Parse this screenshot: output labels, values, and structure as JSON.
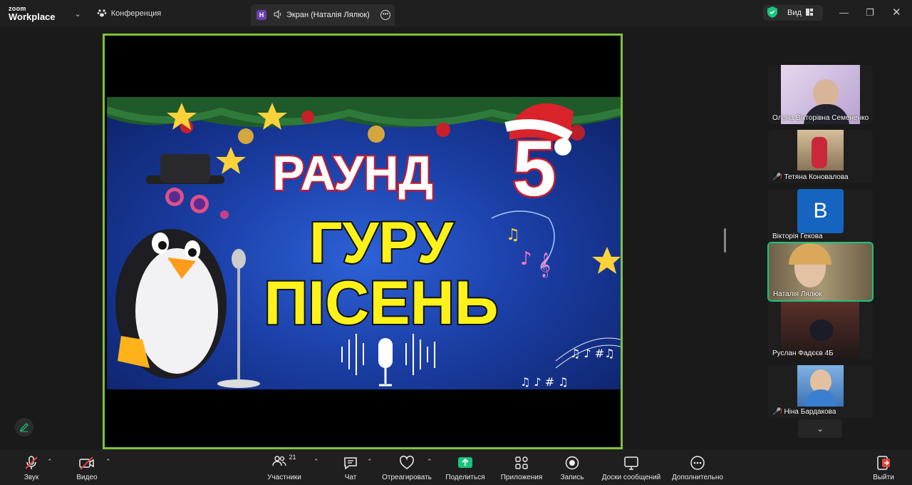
{
  "app": {
    "logo_line1": "zoom",
    "logo_line2": "Workplace"
  },
  "tabs": {
    "conference": "Конференция",
    "screen_badge": "Н",
    "screen": "Экран (Наталія Лялюк)"
  },
  "view": {
    "label": "Вид"
  },
  "slide": {
    "line1": "РАУНД",
    "round_number": "5",
    "line2": "ГУРУ",
    "line3": "ПІСЕНЬ"
  },
  "participants": [
    {
      "name": "Олена Вікторівна Семененко",
      "muted": false,
      "type": "video",
      "bg": "#c9b6d8"
    },
    {
      "name": "Тетяна Коновалова",
      "muted": true,
      "type": "video",
      "bg": "#b8a080"
    },
    {
      "name": "Вікторія Гекова",
      "muted": false,
      "type": "avatar",
      "initial": "В",
      "bg": "#1565c0"
    },
    {
      "name": "Наталія Лялюк",
      "muted": false,
      "type": "video",
      "active": true,
      "bg": "#8a7a5e"
    },
    {
      "name": "Руслан Фадєєв 4Б",
      "muted": false,
      "type": "video",
      "bg": "#3b2a22"
    },
    {
      "name": "Ніна Бардакова",
      "muted": true,
      "type": "video",
      "bg": "#4a86c5"
    }
  ],
  "toolbar": {
    "audio": "Звук",
    "video": "Видео",
    "participants": "Участники",
    "participants_count": "21",
    "chat": "Чат",
    "react": "Отреагировать",
    "share": "Поделиться",
    "apps": "Приложения",
    "record": "Запись",
    "whiteboards": "Доски сообщений",
    "more": "Дополнительно",
    "leave": "Выйти"
  },
  "colors": {
    "active_border": "#7ec23c",
    "share_green": "#19c37d",
    "leave_red": "#e0443c"
  }
}
